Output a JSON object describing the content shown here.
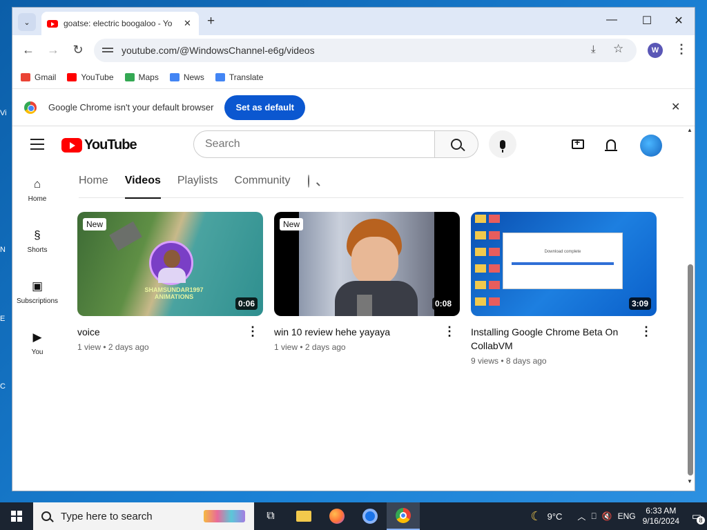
{
  "desktop": {
    "edge_labels": [
      "Vi",
      "N",
      "E",
      "C"
    ]
  },
  "browser": {
    "tab": {
      "title": "goatse: electric boogaloo - Yo"
    },
    "new_tab": "+",
    "url": "youtube.com/@WindowsChannel-e6g/videos",
    "profile_letter": "W",
    "bookmarks": [
      {
        "label": "Gmail",
        "icon": "gmail-icon",
        "color": "#ea4335"
      },
      {
        "label": "YouTube",
        "icon": "youtube-icon",
        "color": "#ff0000"
      },
      {
        "label": "Maps",
        "icon": "maps-icon",
        "color": "#34a853"
      },
      {
        "label": "News",
        "icon": "news-icon",
        "color": "#4285f4"
      },
      {
        "label": "Translate",
        "icon": "translate-icon",
        "color": "#4285f4"
      }
    ],
    "infobar": {
      "text": "Google Chrome isn't your default browser",
      "button": "Set as default"
    }
  },
  "youtube": {
    "logo_text": "YouTube",
    "search_placeholder": "Search",
    "sidebar": [
      {
        "label": "Home",
        "icon": "home-icon"
      },
      {
        "label": "Shorts",
        "icon": "shorts-icon"
      },
      {
        "label": "Subscriptions",
        "icon": "subscriptions-icon"
      },
      {
        "label": "You",
        "icon": "you-icon"
      }
    ],
    "channel_tabs": [
      "Home",
      "Videos",
      "Playlists",
      "Community"
    ],
    "active_tab": "Videos",
    "videos": [
      {
        "title": "voice",
        "meta": "1 view • 2 days ago",
        "duration": "0:06",
        "badge": "New",
        "thumb_caption": "SHAMSUNDAR1997 ANIMATIONS"
      },
      {
        "title": "win 10 review hehe yayaya",
        "meta": "1 view • 2 days ago",
        "duration": "0:08",
        "badge": "New"
      },
      {
        "title": "Installing Google Chrome Beta On CollabVM",
        "meta": "9 views • 8 days ago",
        "duration": "3:09",
        "badge": "",
        "thumb_dialog": "Download complete"
      }
    ]
  },
  "taskbar": {
    "search_placeholder": "Type here to search",
    "weather": "9°C",
    "language": "ENG",
    "time": "6:33 AM",
    "date": "9/16/2024",
    "notification_count": "8"
  }
}
